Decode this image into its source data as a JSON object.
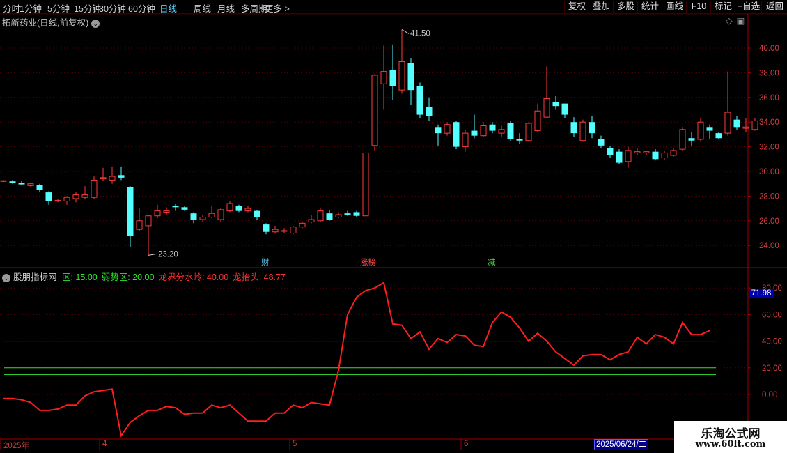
{
  "toolbar": {
    "periods": [
      "分时",
      "1分钟",
      "5分钟",
      "15分钟",
      "30分钟",
      "60分钟",
      "日线",
      "周线",
      "月线",
      "多周期",
      "更多 >"
    ],
    "active_period": "日线",
    "right_buttons": [
      "复权",
      "叠加",
      "多股",
      "统计",
      "画线",
      "F10",
      "标记",
      "+自选",
      "返回"
    ]
  },
  "main_panel": {
    "title": "拓新药业(日线,前复权)",
    "high_label": "41.50",
    "low_label": "23.20",
    "price_axis": [
      "40.00",
      "38.00",
      "36.00",
      "34.00",
      "32.00",
      "30.00",
      "28.00",
      "26.00",
      "24.00"
    ],
    "events": [
      {
        "text": "财",
        "color": "#5fd3ff"
      },
      {
        "text": "涨榜",
        "color": "#ff4a4a"
      },
      {
        "text": "减",
        "color": "#46e046"
      }
    ],
    "candles": [
      [
        29.2,
        29.25,
        29.15,
        29.3
      ],
      [
        29.2,
        29.05,
        29.0,
        29.3
      ],
      [
        29.05,
        28.95,
        28.9,
        29.2
      ],
      [
        28.85,
        29.0,
        28.75,
        29.05
      ],
      [
        28.9,
        28.5,
        28.3,
        29.0
      ],
      [
        28.3,
        27.6,
        27.3,
        28.4
      ],
      [
        27.6,
        27.65,
        27.5,
        27.8
      ],
      [
        27.6,
        27.9,
        27.3,
        28.0
      ],
      [
        27.8,
        28.1,
        27.5,
        28.3
      ],
      [
        27.9,
        28.1,
        27.8,
        28.8
      ],
      [
        27.9,
        29.3,
        27.8,
        29.6
      ],
      [
        29.4,
        29.5,
        29.2,
        30.3
      ],
      [
        29.3,
        29.6,
        29.0,
        30.4
      ],
      [
        29.7,
        29.5,
        29.3,
        30.4
      ],
      [
        28.7,
        24.8,
        23.9,
        28.8
      ],
      [
        25.3,
        26.0,
        25.2,
        27.0
      ],
      [
        25.6,
        26.4,
        23.2,
        26.5
      ],
      [
        26.4,
        26.8,
        26.2,
        27.3
      ],
      [
        26.7,
        26.8,
        26.5,
        27.1
      ],
      [
        27.2,
        27.1,
        26.8,
        27.4
      ],
      [
        27.1,
        26.9,
        26.8,
        27.2
      ],
      [
        26.6,
        26.1,
        25.8,
        26.7
      ],
      [
        26.1,
        26.3,
        25.9,
        26.5
      ],
      [
        26.3,
        26.6,
        26.2,
        27.2
      ],
      [
        26.1,
        26.9,
        25.9,
        27.0
      ],
      [
        26.8,
        27.4,
        26.7,
        27.6
      ],
      [
        27.2,
        26.8,
        26.7,
        27.3
      ],
      [
        26.8,
        27.0,
        26.7,
        27.2
      ],
      [
        26.8,
        26.3,
        26.1,
        26.9
      ],
      [
        25.7,
        25.1,
        24.9,
        25.8
      ],
      [
        25.1,
        25.3,
        25.0,
        25.6
      ],
      [
        25.2,
        25.2,
        25.0,
        25.4
      ],
      [
        25.0,
        25.5,
        24.9,
        25.6
      ],
      [
        25.5,
        25.8,
        25.4,
        25.9
      ],
      [
        25.9,
        26.1,
        25.8,
        26.5
      ],
      [
        26.0,
        26.8,
        25.9,
        27.0
      ],
      [
        26.6,
        26.1,
        26.0,
        26.9
      ],
      [
        26.3,
        26.5,
        26.2,
        26.7
      ],
      [
        26.6,
        26.5,
        26.4,
        26.8
      ],
      [
        26.7,
        26.4,
        26.3,
        26.8
      ],
      [
        26.4,
        31.5,
        26.4,
        31.5
      ],
      [
        32.1,
        37.8,
        31.7,
        37.9
      ],
      [
        37.1,
        38.1,
        35.0,
        40.2
      ],
      [
        38.2,
        36.9,
        35.8,
        40.3
      ],
      [
        36.6,
        38.9,
        36.3,
        41.5
      ],
      [
        38.8,
        36.6,
        35.4,
        39.2
      ],
      [
        36.9,
        34.6,
        34.3,
        37.2
      ],
      [
        35.2,
        34.5,
        34.1,
        36.0
      ],
      [
        33.6,
        33.1,
        32.1,
        33.8
      ],
      [
        33.1,
        33.8,
        32.9,
        34.0
      ],
      [
        34.0,
        32.0,
        31.8,
        34.1
      ],
      [
        32.0,
        33.1,
        31.6,
        33.4
      ],
      [
        33.3,
        32.9,
        32.7,
        34.6
      ],
      [
        32.9,
        33.7,
        32.8,
        34.0
      ],
      [
        33.8,
        33.3,
        33.1,
        34.0
      ],
      [
        33.1,
        33.4,
        32.8,
        33.7
      ],
      [
        33.9,
        32.6,
        32.5,
        34.1
      ],
      [
        32.6,
        32.5,
        32.2,
        33.1
      ],
      [
        32.5,
        33.9,
        32.4,
        34.0
      ],
      [
        33.3,
        34.9,
        33.2,
        35.5
      ],
      [
        34.4,
        35.9,
        34.3,
        38.5
      ],
      [
        35.6,
        35.3,
        35.0,
        36.1
      ],
      [
        35.5,
        34.6,
        34.3,
        35.5
      ],
      [
        34.0,
        33.1,
        32.8,
        34.4
      ],
      [
        32.5,
        34.0,
        32.4,
        34.2
      ],
      [
        34.0,
        33.1,
        32.7,
        34.5
      ],
      [
        32.6,
        32.1,
        31.9,
        32.9
      ],
      [
        31.9,
        31.3,
        31.1,
        32.1
      ],
      [
        31.6,
        30.7,
        30.6,
        31.8
      ],
      [
        30.8,
        31.7,
        30.3,
        32.0
      ],
      [
        31.5,
        31.6,
        31.3,
        31.9
      ],
      [
        31.5,
        31.6,
        31.3,
        31.7
      ],
      [
        31.6,
        31.0,
        30.9,
        31.8
      ],
      [
        31.1,
        31.5,
        30.9,
        31.7
      ],
      [
        31.3,
        31.7,
        31.2,
        31.9
      ],
      [
        31.8,
        33.4,
        31.7,
        33.6
      ],
      [
        32.7,
        32.5,
        32.1,
        33.2
      ],
      [
        32.6,
        34.0,
        32.4,
        34.3
      ],
      [
        33.6,
        33.3,
        32.6,
        33.8
      ],
      [
        33.1,
        32.7,
        32.6,
        33.2
      ],
      [
        33.1,
        34.8,
        32.9,
        38.1
      ],
      [
        34.2,
        33.6,
        33.4,
        34.5
      ],
      [
        33.5,
        33.6,
        33.2,
        34.3
      ],
      [
        33.4,
        34.1,
        33.3,
        34.3
      ]
    ]
  },
  "indicator_panel": {
    "name": "股朋指标网",
    "items": [
      {
        "text": "区: 15.00",
        "color": "#2ee62e"
      },
      {
        "text": "弱势区: 20.00",
        "color": "#2ee62e"
      },
      {
        "text": "龙界分水岭: 40.00",
        "color": "#ff3030"
      },
      {
        "text": "龙抬头: 48.77",
        "color": "#ff3030"
      }
    ],
    "axis": [
      "80.00",
      "60.00",
      "40.00",
      "20.00",
      "0.00"
    ],
    "current_value": "71.98",
    "ref_lines": [
      {
        "value": 40,
        "color": "#e00000"
      },
      {
        "value": 20,
        "color": "#2ee62e"
      },
      {
        "value": 15,
        "color": "#2ee62e"
      }
    ],
    "series": [
      -3,
      -3,
      -4,
      -6,
      -12,
      -12,
      -11,
      -8,
      -8,
      -1,
      2,
      3,
      4,
      -31,
      -21,
      -16,
      -12,
      -12,
      -9,
      -10,
      -15,
      -14,
      -14,
      -8,
      -10,
      -8,
      -14,
      -20,
      -20,
      -20,
      -14,
      -14,
      -8,
      -10,
      -6,
      -7,
      -8,
      18,
      60,
      73,
      78,
      80,
      84,
      53,
      52,
      42,
      47,
      34,
      42,
      39,
      45,
      44,
      37,
      36,
      54,
      62,
      58,
      50,
      40,
      46,
      40,
      32,
      27,
      22,
      29,
      30,
      30,
      26,
      30,
      32,
      43,
      38,
      45,
      43,
      38,
      54,
      45,
      45,
      48
    ]
  },
  "x_axis": {
    "labels": [
      "2025年",
      "4",
      "5",
      "6"
    ],
    "cursor_date": "2025/06/24/二"
  },
  "watermark": {
    "line1": "乐淘公式网",
    "line2": "www.60lt.com"
  }
}
